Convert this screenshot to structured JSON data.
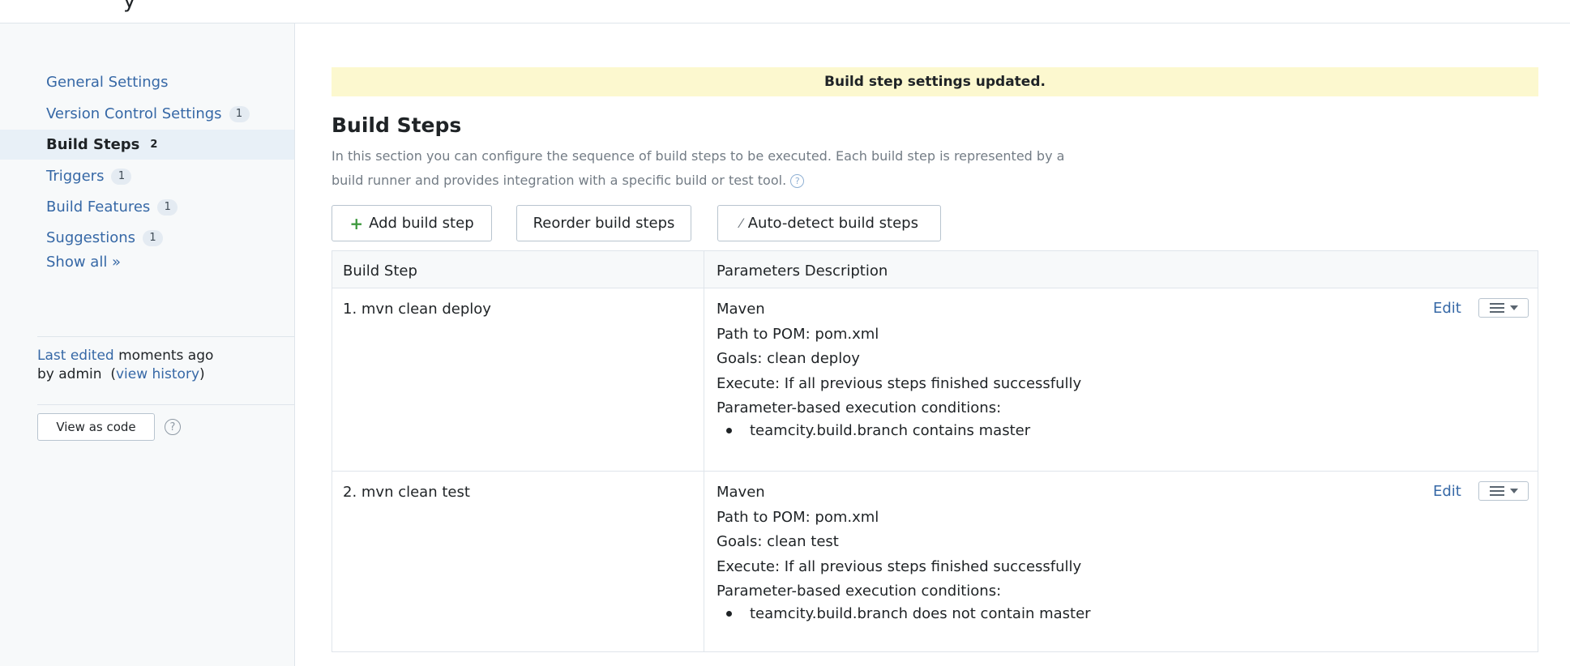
{
  "header": {
    "cut_glyph": "y"
  },
  "sidebar": {
    "items": [
      {
        "label": "General Settings",
        "badge": null,
        "active": false
      },
      {
        "label": "Version Control Settings",
        "badge": "1",
        "active": false
      },
      {
        "label": "Build Steps",
        "badge": "2",
        "active": true
      },
      {
        "label": "Triggers",
        "badge": "1",
        "active": false
      },
      {
        "label": "Build Features",
        "badge": "1",
        "active": false
      },
      {
        "label": "Suggestions",
        "badge": "1",
        "active": false
      }
    ],
    "show_all": "Show all »",
    "last_edited": {
      "prefix": "Last edited",
      "when": "moments ago",
      "by": "by admin",
      "history_link": "view history"
    },
    "view_as_code": "View as code",
    "help_glyph": "?"
  },
  "main": {
    "banner": "Build step settings updated.",
    "title": "Build Steps",
    "description_line1": "In this section you can configure the sequence of build steps to be executed. Each build step is represented by a",
    "description_line2": "build runner and provides integration with a specific build or test tool.",
    "help_glyph": "?",
    "buttons": {
      "add": "Add build step",
      "add_icon": "+",
      "reorder": "Reorder build steps",
      "autodetect": "Auto-detect build steps",
      "autodetect_icon": "⁄"
    },
    "table": {
      "headers": [
        "Build Step",
        "Parameters Description"
      ],
      "edit_label": "Edit",
      "rows": [
        {
          "name": "1. mvn clean deploy",
          "runner": "Maven",
          "pom": "Path to POM: pom.xml",
          "goals": "Goals: clean deploy",
          "execute": "Execute: If all previous steps finished successfully",
          "conditions_title": "Parameter-based execution conditions:",
          "condition": "teamcity.build.branch contains master"
        },
        {
          "name": "2. mvn clean test",
          "runner": "Maven",
          "pom": "Path to POM: pom.xml",
          "goals": "Goals: clean test",
          "execute": "Execute: If all previous steps finished successfully",
          "conditions_title": "Parameter-based execution conditions:",
          "condition": "teamcity.build.branch does not contain master"
        }
      ]
    }
  }
}
